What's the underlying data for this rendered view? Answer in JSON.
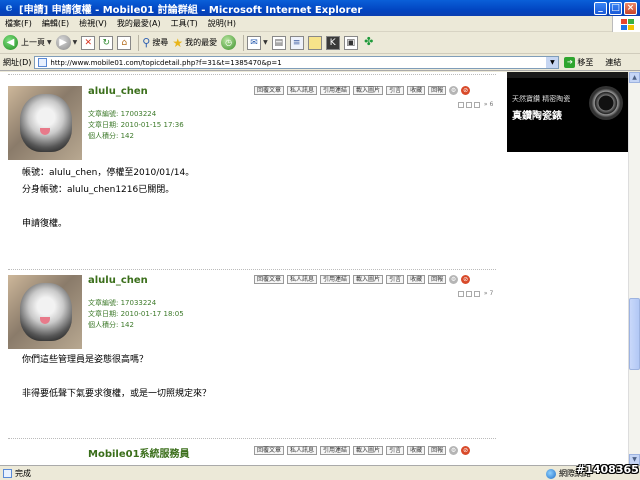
{
  "window": {
    "title": "[申請] 申請復權 - Mobile01 討論群組 - Microsoft Internet Explorer"
  },
  "menu": {
    "items": [
      "檔案(F)",
      "編輯(E)",
      "檢視(V)",
      "我的最愛(A)",
      "工具(T)",
      "說明(H)"
    ]
  },
  "toolbar": {
    "back_label": "上一頁",
    "search_label": "搜尋",
    "favorites_label": "我的最愛"
  },
  "address": {
    "label": "網址(D)",
    "url": "http://www.mobile01.com/topicdetail.php?f=31&t=1385470&p=1",
    "go_label": "移至",
    "links_label": "連結"
  },
  "ad": {
    "line1": "天然寶鑽 精密陶瓷",
    "line2": "真鑽陶瓷錶"
  },
  "post_actions": [
    "回覆文章",
    "私人訊息",
    "引用連結",
    "載入圖片",
    "引言",
    "收藏",
    "回報"
  ],
  "posts": [
    {
      "username": "alulu_chen",
      "post_id": "文章編號: 17003224",
      "post_date": "文章日期: 2010-01-15 17:36",
      "points": "個人積分: 142",
      "floor": "» 6",
      "lines": [
        "帳號：alulu_chen，停權至2010/01/14。",
        "分身帳號：alulu_chen1216已關閉。",
        "",
        "申請復權。"
      ]
    },
    {
      "username": "alulu_chen",
      "post_id": "文章編號: 17033224",
      "post_date": "文章日期: 2010-01-17 18:05",
      "points": "個人積分: 142",
      "floor": "» 7",
      "lines": [
        "你們這些管理員是姿態很高嗎？",
        "",
        "非得要低聲下氣要求復權，或是一切照規定來？"
      ]
    },
    {
      "username": "Mobile01系統服務員"
    }
  ],
  "status": {
    "text": "完成",
    "zone": "網際網路"
  },
  "watermark": "#1408365"
}
